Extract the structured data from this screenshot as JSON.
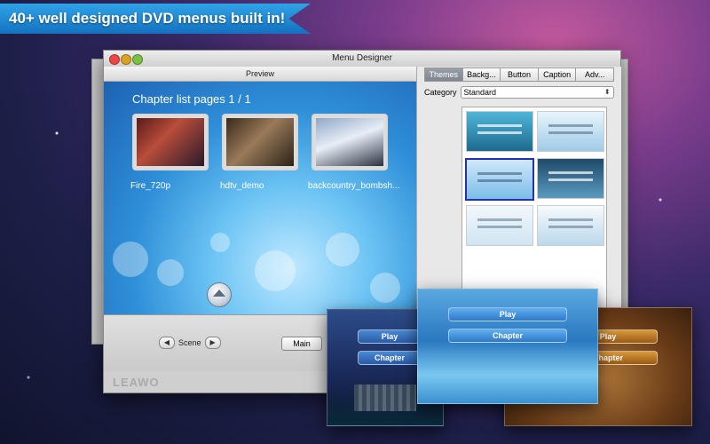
{
  "banner": {
    "text": "40+ well designed DVD menus built in!"
  },
  "window": {
    "title": "Menu Designer"
  },
  "preview": {
    "header": "Preview",
    "chapter_title": "Chapter list pages 1 / 1",
    "items": [
      {
        "label": "Fire_720p"
      },
      {
        "label": "hdtv_demo"
      },
      {
        "label": "backcountry_bombsh..."
      }
    ]
  },
  "controls": {
    "scene_label": "Scene",
    "main_button": "Main",
    "prev_icon": "chevron-left-icon",
    "next_icon": "chevron-right-icon"
  },
  "footer": {
    "logo": "LEAWO"
  },
  "tabs": [
    {
      "label": "Themes"
    },
    {
      "label": "Backg..."
    },
    {
      "label": "Button"
    },
    {
      "label": "Caption"
    },
    {
      "label": "Adv..."
    }
  ],
  "category": {
    "label": "Category",
    "value": "Standard"
  },
  "popups": {
    "left": {
      "play": "Play",
      "chapter": "Chapter"
    },
    "center": {
      "play": "Play",
      "chapter": "Chapter"
    },
    "right": {
      "play": "Play",
      "chapter": "Chapter"
    }
  }
}
